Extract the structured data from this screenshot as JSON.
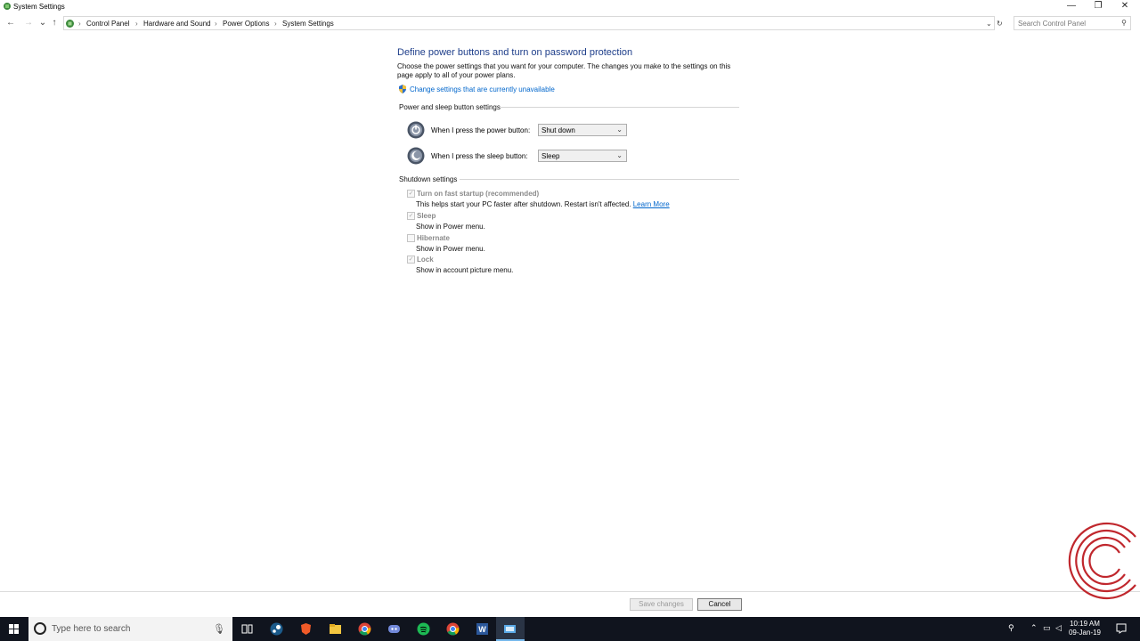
{
  "window": {
    "title": "System Settings",
    "minimize": "—",
    "restore": "❐",
    "close": "✕"
  },
  "nav": {
    "back": "←",
    "forward": "→",
    "recent": "⌄",
    "up": "↑",
    "breadcrumbs": [
      "Control Panel",
      "Hardware and Sound",
      "Power Options",
      "System Settings"
    ],
    "separator": "›",
    "dropdown": "⌄",
    "refresh": "↻",
    "search_placeholder": "Search Control Panel",
    "search_icon": "⚲"
  },
  "main": {
    "heading": "Define power buttons and turn on password protection",
    "description": "Choose the power settings that you want for your computer. The changes you make to the settings on this page apply to all of your power plans.",
    "change_link": "Change settings that are currently unavailable",
    "power_section": {
      "label": "Power and sleep button settings",
      "power_button_label": "When I press the power button:",
      "power_button_value": "Shut down",
      "sleep_button_label": "When I press the sleep button:",
      "sleep_button_value": "Sleep"
    },
    "shutdown_section": {
      "label": "Shutdown settings",
      "items": [
        {
          "label": "Turn on fast startup (recommended)",
          "sub": "This helps start your PC faster after shutdown. Restart isn't affected.",
          "link": "Learn More",
          "checked": true
        },
        {
          "label": "Sleep",
          "sub": "Show in Power menu.",
          "checked": true
        },
        {
          "label": "Hibernate",
          "sub": "Show in Power menu.",
          "checked": false
        },
        {
          "label": "Lock",
          "sub": "Show in account picture menu.",
          "checked": true
        }
      ]
    }
  },
  "footer": {
    "save_label": "Save changes",
    "cancel_label": "Cancel"
  },
  "taskbar": {
    "search_text": "Type here to search",
    "apps": [
      "task-view",
      "steam",
      "brave",
      "file-explorer",
      "chrome",
      "discord",
      "spotify",
      "chrome-alt",
      "word",
      "control-panel"
    ],
    "time": "10:19 AM",
    "date": "09-Jan-19"
  },
  "colors": {
    "heading": "#1e3e8a",
    "link": "#0066cc",
    "taskbar": "#10141e"
  }
}
